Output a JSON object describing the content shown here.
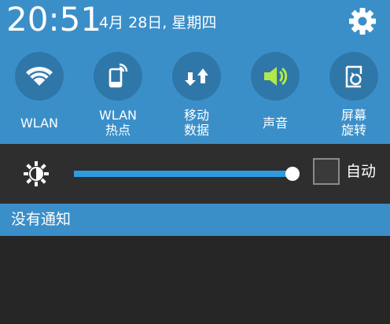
{
  "status": {
    "time": "20:51",
    "date": "4月 28日, 星期四"
  },
  "quick_settings": [
    {
      "id": "wlan",
      "label": "WLAN",
      "icon": "wifi-icon",
      "active": false
    },
    {
      "id": "hotspot",
      "label": "WLAN\n热点",
      "icon": "hotspot-icon",
      "active": false
    },
    {
      "id": "mobile-data",
      "label": "移动\n数据",
      "icon": "mobile-data-icon",
      "active": false
    },
    {
      "id": "sound",
      "label": "声音",
      "icon": "volume-icon",
      "active": true
    },
    {
      "id": "auto-rotate",
      "label": "屏幕\n旋转",
      "icon": "rotate-icon",
      "active": false
    }
  ],
  "brightness": {
    "level": 1.0,
    "auto_label": "自动",
    "auto_checked": false
  },
  "notifications": {
    "header": "没有通知"
  },
  "colors": {
    "panel": "#3b8fc9",
    "toggle_circle": "#2f77a8",
    "active_icon": "#b2e84a",
    "slider_fill": "#2f9bdf",
    "background": "#262626"
  }
}
